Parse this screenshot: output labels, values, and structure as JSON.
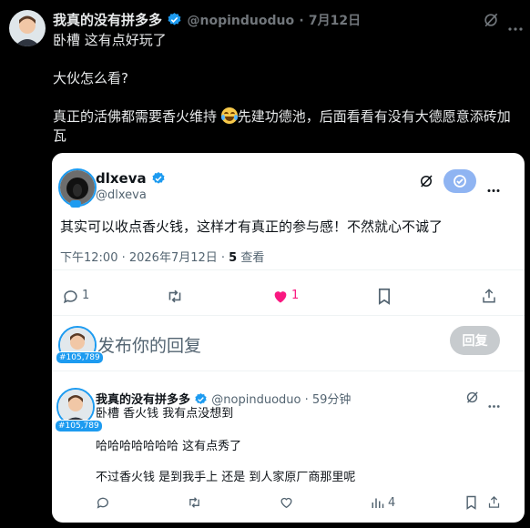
{
  "outer_tweet": {
    "author_name": "我真的没有拼多多",
    "handle": "@nopinduoduo",
    "separator": "·",
    "date": "7月12日",
    "lines": [
      "卧槽 这有点好玩了",
      "大伙怎么看?",
      "真正的活佛都需要香火维持",
      "先建功德池，后面看看有没有大德愿意添砖加",
      "瓦"
    ]
  },
  "quoted_card": {
    "author_name": "dlxeva",
    "handle": "@dlxeva",
    "text": "其实可以收点香火钱，这样才有真正的参与感！不然就心不诚了",
    "timestamp": "下午12:00 · 2026年7月12日 · ",
    "views_count": "5",
    "views_label": " 查看",
    "actions": {
      "reply_count": "1",
      "like_count": "1"
    },
    "compose": {
      "placeholder": "发布你的回复",
      "button": "回复",
      "badge": "#105,789"
    },
    "reply": {
      "author_name": "我真的没有拼多多",
      "handle": "@nopinduoduo",
      "time": "· 59分钟",
      "badge": "#105,789",
      "lines": [
        "卧槽 香火钱 我有点没想到",
        "哈哈哈哈哈哈哈 这有点秀了",
        "不过香火钱 是到我手上 还是 到人家原厂商那里呢"
      ],
      "views": "4"
    }
  },
  "colors": {
    "accent": "#1d9bf0",
    "like": "#f91880",
    "background": "#000000"
  }
}
